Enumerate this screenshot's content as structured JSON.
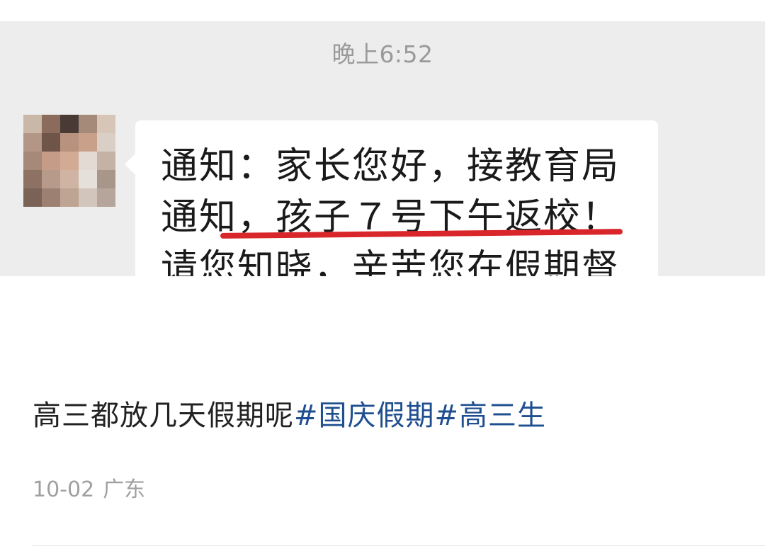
{
  "chat_screenshot": {
    "time": "晚上6:52",
    "message_lines": [
      "通知：家长您好，接教育局",
      "通知，孩子７号下午返校！",
      "请您知晓，辛苦您在假期督"
    ]
  },
  "post": {
    "text": "高三都放几天假期呢",
    "hashtags": [
      "#国庆假期",
      "#高三生"
    ],
    "date": "10-02",
    "location": "广东"
  },
  "colors": {
    "hashtag": "#1f4f8f",
    "underline": "#d8262a",
    "chat_background": "#ededed"
  }
}
